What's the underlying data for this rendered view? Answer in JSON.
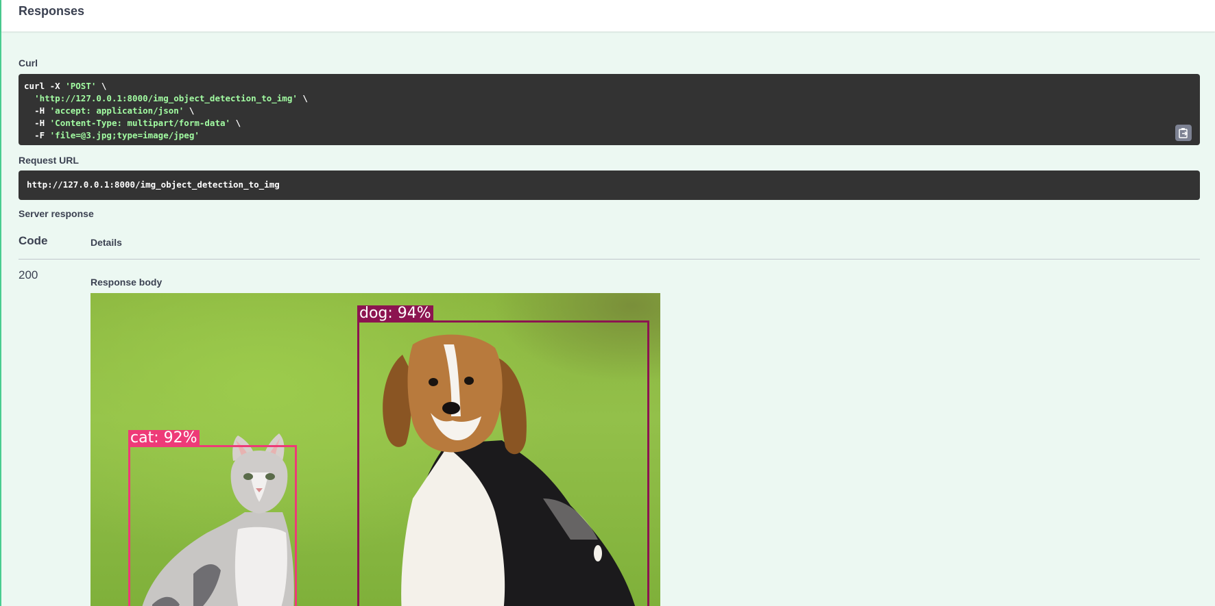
{
  "header": {
    "title": "Responses"
  },
  "curl": {
    "label": "Curl",
    "line1_cmd": "curl -X ",
    "line1_str": "'POST'",
    "line1_end": " \\",
    "line2_str": "'http://127.0.0.1:8000/img_object_detection_to_img'",
    "line2_end": " \\",
    "line3_cmd": "-H ",
    "line3_str": "'accept: application/json'",
    "line3_end": " \\",
    "line4_cmd": "-H ",
    "line4_str": "'Content-Type: multipart/form-data'",
    "line4_end": " \\",
    "line5_cmd": "-F ",
    "line5_str": "'file=@3.jpg;type=image/jpeg'"
  },
  "request_url": {
    "label": "Request URL",
    "value": "http://127.0.0.1:8000/img_object_detection_to_img"
  },
  "server_response": {
    "label": "Server response",
    "col_code": "Code",
    "col_details": "Details",
    "code": "200",
    "body_label": "Response body"
  },
  "detections": [
    {
      "label": "dog: 94%",
      "color": "#8c1450"
    },
    {
      "label": "cat: 92%",
      "color": "#ee3a78"
    }
  ],
  "icons": {
    "copy": "clipboard-icon"
  },
  "colors": {
    "accent": "#49cc90",
    "background": "#ecf8f2",
    "code_bg": "#333333",
    "string": "#a2fca2"
  }
}
